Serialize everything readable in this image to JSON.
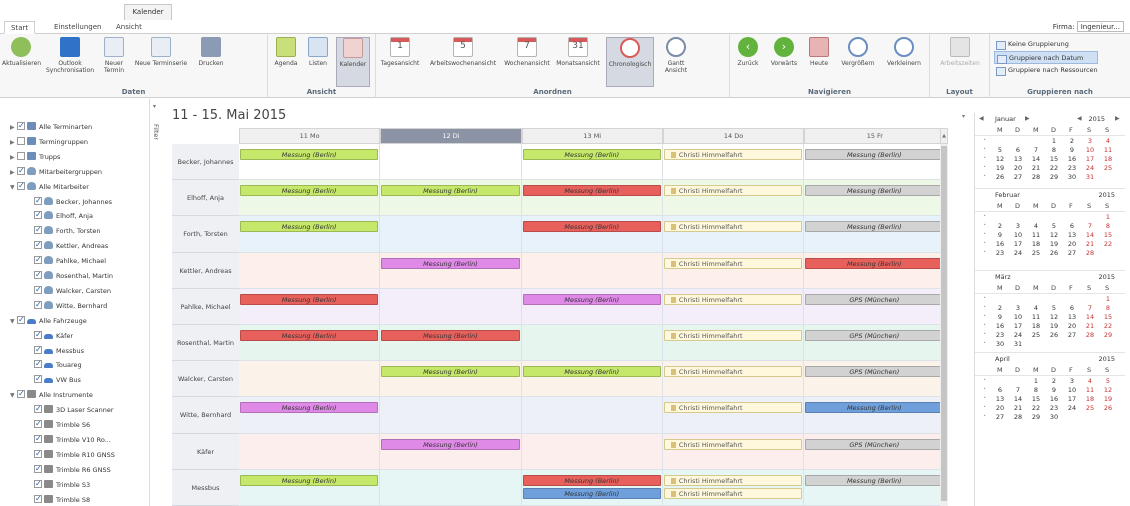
{
  "ribbon": {
    "context_tab": "Kalender",
    "tabs": [
      "Start",
      "Einstellungen",
      "Ansicht"
    ],
    "firma_label": "Firma:",
    "firma_value": "Ingenieur...",
    "groups": {
      "daten": {
        "label": "Daten",
        "buttons": [
          {
            "label": "Aktualisieren",
            "icon": "refresh-icon"
          },
          {
            "label": "Outlook Synchronisation",
            "icon": "outlook-icon"
          },
          {
            "label": "Neuer Termin",
            "icon": "new-appointment-icon"
          },
          {
            "label": "Neue Terminserie",
            "icon": "new-series-icon"
          },
          {
            "label": "Drucken",
            "icon": "printer-icon"
          }
        ]
      },
      "ansicht": {
        "label": "Ansicht",
        "buttons": [
          {
            "label": "Agenda",
            "icon": "agenda-icon"
          },
          {
            "label": "Listen",
            "icon": "list-icon"
          },
          {
            "label": "Kalender",
            "icon": "calendar-icon"
          }
        ]
      },
      "anordnen": {
        "label": "Anordnen",
        "buttons": [
          {
            "label": "Tagesansicht",
            "icon": "day-view-icon",
            "num": "1"
          },
          {
            "label": "Arbeitswochenansicht",
            "icon": "workweek-view-icon",
            "num": "5"
          },
          {
            "label": "Wochenansicht",
            "icon": "week-view-icon",
            "num": "7"
          },
          {
            "label": "Monatsansicht",
            "icon": "month-view-icon",
            "num": "31"
          },
          {
            "label": "Chronologisch",
            "icon": "timeline-icon"
          },
          {
            "label": "Gantt Ansicht",
            "icon": "gantt-icon"
          }
        ]
      },
      "navigieren": {
        "label": "Navigieren",
        "buttons": [
          {
            "label": "Zurück",
            "icon": "back-icon"
          },
          {
            "label": "Vorwärts",
            "icon": "forward-icon"
          },
          {
            "label": "Heute",
            "icon": "today-icon"
          },
          {
            "label": "Vergrößern",
            "icon": "zoom-in-icon"
          },
          {
            "label": "Verkleinern",
            "icon": "zoom-out-icon"
          }
        ]
      },
      "layout": {
        "label": "Layout",
        "buttons": [
          {
            "label": "Arbeitszeiten",
            "icon": "work-hours-icon"
          }
        ]
      },
      "gruppieren": {
        "label": "Gruppieren nach",
        "options": [
          "Keine Gruppierung",
          "Gruppiere nach Datum",
          "Gruppiere nach Ressourcen"
        ]
      }
    }
  },
  "left_panel": {
    "filter_label": "Filter",
    "tree": [
      {
        "label": "Alle Terminarten",
        "level": 0,
        "arrow": "▶",
        "checked": true,
        "icon": "group"
      },
      {
        "label": "Termingruppen",
        "level": 0,
        "arrow": "▶",
        "checked": false,
        "icon": "group"
      },
      {
        "label": "Trupps",
        "level": 0,
        "arrow": "▶",
        "checked": false,
        "icon": "group"
      },
      {
        "label": "Mitarbeitergruppen",
        "level": 0,
        "arrow": "▶",
        "checked": true,
        "icon": "person"
      },
      {
        "label": "Alle Mitarbeiter",
        "level": 0,
        "arrow": "▼",
        "checked": true,
        "icon": "person"
      },
      {
        "label": "Becker, Johannes",
        "level": 1,
        "checked": true,
        "icon": "person"
      },
      {
        "label": "Elhoff, Anja",
        "level": 1,
        "checked": true,
        "icon": "person"
      },
      {
        "label": "Forth, Torsten",
        "level": 1,
        "checked": true,
        "icon": "person"
      },
      {
        "label": "Kettler, Andreas",
        "level": 1,
        "checked": true,
        "icon": "person"
      },
      {
        "label": "Pahlke, Michael",
        "level": 1,
        "checked": true,
        "icon": "person"
      },
      {
        "label": "Rosenthal, Martin",
        "level": 1,
        "checked": true,
        "icon": "person"
      },
      {
        "label": "Walcker, Carsten",
        "level": 1,
        "checked": true,
        "icon": "person"
      },
      {
        "label": "Witte, Bernhard",
        "level": 1,
        "checked": true,
        "icon": "person"
      },
      {
        "label": "Alle Fahrzeuge",
        "level": 0,
        "arrow": "▼",
        "checked": true,
        "icon": "car"
      },
      {
        "label": "Käfer",
        "level": 1,
        "checked": true,
        "icon": "car"
      },
      {
        "label": "Messbus",
        "level": 1,
        "checked": true,
        "icon": "car"
      },
      {
        "label": "Touareg",
        "level": 1,
        "checked": true,
        "icon": "car"
      },
      {
        "label": "VW Bus",
        "level": 1,
        "checked": true,
        "icon": "car"
      },
      {
        "label": "Alle Instrumente",
        "level": 0,
        "arrow": "▼",
        "checked": true,
        "icon": "tool"
      },
      {
        "label": "3D Laser Scanner",
        "level": 1,
        "checked": true,
        "icon": "tool"
      },
      {
        "label": "Trimble S6",
        "level": 1,
        "checked": true,
        "icon": "tool"
      },
      {
        "label": "Trimble V10 Ro...",
        "level": 1,
        "checked": true,
        "icon": "tool"
      },
      {
        "label": "Trimble R10 GNSS",
        "level": 1,
        "checked": true,
        "icon": "tool"
      },
      {
        "label": "Trimble R6 GNSS",
        "level": 1,
        "checked": true,
        "icon": "tool"
      },
      {
        "label": "Trimble S3",
        "level": 1,
        "checked": true,
        "icon": "tool"
      },
      {
        "label": "Trimble S8",
        "level": 1,
        "checked": true,
        "icon": "tool"
      }
    ]
  },
  "scheduler": {
    "date_range": "11 - 15. Mai 2015",
    "days": [
      {
        "label": "11 Mo",
        "today": false
      },
      {
        "label": "12 Di",
        "today": true
      },
      {
        "label": "13 Mi",
        "today": false
      },
      {
        "label": "14 Do",
        "today": false
      },
      {
        "label": "15 Fr",
        "today": false
      }
    ],
    "row_colors": [
      "#ffffff",
      "#eef8e6",
      "#e8f2fb",
      "#fdf0ea",
      "#f3eefa",
      "#e6f6ee",
      "#fbf3ea",
      "#eef0f8",
      "#fdeeee",
      "#e6f6f4"
    ],
    "event_colors": {
      "lime": "#c6e86a",
      "red": "#e8605c",
      "magenta": "#e08ae8",
      "gray": "#d2d2d2",
      "blue": "#6fa0dc",
      "holiday": "#fff8dc"
    },
    "rows": [
      {
        "name": "Becker, Johannes",
        "events": [
          {
            "day": 0,
            "slot": 0,
            "text": "Messung (Berlin)",
            "color": "lime"
          },
          {
            "day": 2,
            "slot": 0,
            "text": "Messung (Berlin)",
            "color": "lime"
          },
          {
            "day": 3,
            "slot": 0,
            "text": "Christi Himmelfahrt",
            "color": "holiday"
          },
          {
            "day": 4,
            "slot": 0,
            "text": "Messung (Berlin)",
            "color": "gray"
          }
        ]
      },
      {
        "name": "Elhoff, Anja",
        "events": [
          {
            "day": 0,
            "slot": 0,
            "text": "Messung (Berlin)",
            "color": "lime"
          },
          {
            "day": 1,
            "slot": 0,
            "text": "Messung (Berlin)",
            "color": "lime"
          },
          {
            "day": 2,
            "slot": 0,
            "text": "Messung (Berlin)",
            "color": "red"
          },
          {
            "day": 3,
            "slot": 0,
            "text": "Christi Himmelfahrt",
            "color": "holiday"
          },
          {
            "day": 4,
            "slot": 0,
            "text": "Messung (Berlin)",
            "color": "gray"
          }
        ]
      },
      {
        "name": "Forth, Torsten",
        "events": [
          {
            "day": 0,
            "slot": 0,
            "text": "Messung (Berlin)",
            "color": "lime"
          },
          {
            "day": 2,
            "slot": 0,
            "text": "Messung (Berlin)",
            "color": "red"
          },
          {
            "day": 3,
            "slot": 0,
            "text": "Christi Himmelfahrt",
            "color": "holiday"
          },
          {
            "day": 4,
            "slot": 0,
            "text": "Messung (Berlin)",
            "color": "gray"
          }
        ]
      },
      {
        "name": "Kettler, Andreas",
        "events": [
          {
            "day": 1,
            "slot": 0,
            "text": "Messung (Berlin)",
            "color": "magenta"
          },
          {
            "day": 3,
            "slot": 0,
            "text": "Christi Himmelfahrt",
            "color": "holiday"
          },
          {
            "day": 4,
            "slot": 0,
            "text": "Messung (Berlin)",
            "color": "red"
          }
        ]
      },
      {
        "name": "Pahlke, Michael",
        "events": [
          {
            "day": 0,
            "slot": 0,
            "text": "Messung (Berlin)",
            "color": "red"
          },
          {
            "day": 2,
            "slot": 0,
            "text": "Messung (Berlin)",
            "color": "magenta"
          },
          {
            "day": 3,
            "slot": 0,
            "text": "Christi Himmelfahrt",
            "color": "holiday"
          },
          {
            "day": 4,
            "slot": 0,
            "text": "GPS (München)",
            "color": "gray"
          }
        ]
      },
      {
        "name": "Rosenthal, Martin",
        "events": [
          {
            "day": 0,
            "slot": 0,
            "text": "Messung (Berlin)",
            "color": "red"
          },
          {
            "day": 1,
            "slot": 0,
            "text": "Messung (Berlin)",
            "color": "red"
          },
          {
            "day": 3,
            "slot": 0,
            "text": "Christi Himmelfahrt",
            "color": "holiday"
          },
          {
            "day": 4,
            "slot": 0,
            "text": "GPS (München)",
            "color": "gray"
          }
        ]
      },
      {
        "name": "Walcker, Carsten",
        "events": [
          {
            "day": 1,
            "slot": 0,
            "text": "Messung (Berlin)",
            "color": "lime"
          },
          {
            "day": 2,
            "slot": 0,
            "text": "Messung (Berlin)",
            "color": "lime"
          },
          {
            "day": 3,
            "slot": 0,
            "text": "Christi Himmelfahrt",
            "color": "holiday"
          },
          {
            "day": 4,
            "slot": 0,
            "text": "GPS (München)",
            "color": "gray"
          }
        ]
      },
      {
        "name": "Witte, Bernhard",
        "events": [
          {
            "day": 0,
            "slot": 0,
            "text": "Messung (Berlin)",
            "color": "magenta"
          },
          {
            "day": 3,
            "slot": 0,
            "text": "Christi Himmelfahrt",
            "color": "holiday"
          },
          {
            "day": 4,
            "slot": 0,
            "text": "Messung (Berlin)",
            "color": "blue"
          }
        ]
      },
      {
        "name": "Käfer",
        "events": [
          {
            "day": 1,
            "slot": 0,
            "text": "Messung (Berlin)",
            "color": "magenta"
          },
          {
            "day": 3,
            "slot": 0,
            "text": "Christi Himmelfahrt",
            "color": "holiday"
          },
          {
            "day": 4,
            "slot": 0,
            "text": "GPS (München)",
            "color": "gray"
          }
        ]
      },
      {
        "name": "Messbus",
        "events": [
          {
            "day": 0,
            "slot": 0,
            "text": "Messung (Berlin)",
            "color": "lime"
          },
          {
            "day": 2,
            "slot": 0,
            "text": "Messung (Berlin)",
            "color": "red"
          },
          {
            "day": 3,
            "slot": 0,
            "text": "Christi Himmelfahrt",
            "color": "holiday"
          },
          {
            "day": 4,
            "slot": 0,
            "text": "Messung (Berlin)",
            "color": "gray"
          },
          {
            "day": 2,
            "slot": 1,
            "text": "Messung (Berlin)",
            "color": "blue"
          },
          {
            "day": 3,
            "slot": 1,
            "text": "Christi Himmelfahrt",
            "color": "holiday"
          }
        ]
      }
    ]
  },
  "mini_calendar": {
    "prev_label": "◀",
    "next_label": "▶",
    "dow": [
      "M",
      "D",
      "M",
      "D",
      "F",
      "S",
      "S"
    ],
    "months": [
      {
        "name": "Januar",
        "year": "2015",
        "weeks": [
          [
            "",
            "",
            "",
            "1",
            "2",
            "3",
            "4"
          ],
          [
            "5",
            "6",
            "7",
            "8",
            "9",
            "10",
            "11"
          ],
          [
            "12",
            "13",
            "14",
            "15",
            "16",
            "17",
            "18"
          ],
          [
            "19",
            "20",
            "21",
            "22",
            "23",
            "24",
            "25"
          ],
          [
            "26",
            "27",
            "28",
            "29",
            "30",
            "31",
            ""
          ]
        ]
      },
      {
        "name": "Februar",
        "year": "2015",
        "weeks": [
          [
            "",
            "",
            "",
            "",
            "",
            "",
            "1"
          ],
          [
            "2",
            "3",
            "4",
            "5",
            "6",
            "7",
            "8"
          ],
          [
            "9",
            "10",
            "11",
            "12",
            "13",
            "14",
            "15"
          ],
          [
            "16",
            "17",
            "18",
            "19",
            "20",
            "21",
            "22"
          ],
          [
            "23",
            "24",
            "25",
            "26",
            "27",
            "28",
            ""
          ]
        ]
      },
      {
        "name": "März",
        "year": "2015",
        "weeks": [
          [
            "",
            "",
            "",
            "",
            "",
            "",
            "1"
          ],
          [
            "2",
            "3",
            "4",
            "5",
            "6",
            "7",
            "8"
          ],
          [
            "9",
            "10",
            "11",
            "12",
            "13",
            "14",
            "15"
          ],
          [
            "16",
            "17",
            "18",
            "19",
            "20",
            "21",
            "22"
          ],
          [
            "23",
            "24",
            "25",
            "26",
            "27",
            "28",
            "29"
          ],
          [
            "30",
            "31",
            "",
            "",
            "",
            "",
            ""
          ]
        ]
      },
      {
        "name": "April",
        "year": "2015",
        "weeks": [
          [
            "",
            "",
            "1",
            "2",
            "3",
            "4",
            "5"
          ],
          [
            "6",
            "7",
            "8",
            "9",
            "10",
            "11",
            "12"
          ],
          [
            "13",
            "14",
            "15",
            "16",
            "17",
            "18",
            "19"
          ],
          [
            "20",
            "21",
            "22",
            "23",
            "24",
            "25",
            "26"
          ],
          [
            "27",
            "28",
            "29",
            "30",
            "",
            "",
            ""
          ]
        ]
      }
    ]
  }
}
